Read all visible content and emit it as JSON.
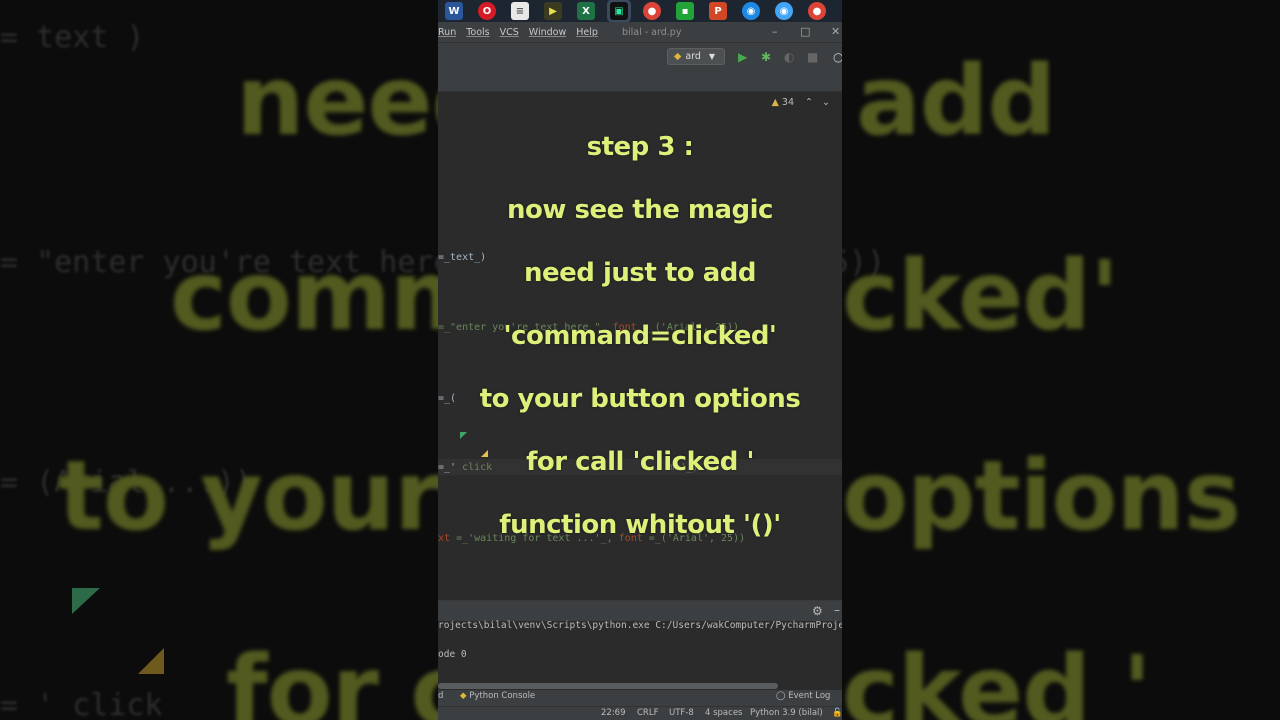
{
  "background": {
    "code_lines": [
      "= text )",
      "= \"enter you're text here \" font = ('Arial', 25))",
      "= (Arial ...))",
      "= ' click",
      "= '' "
    ],
    "big_words": [
      "need",
      "add",
      "comm",
      "cked'",
      "to your",
      "options",
      "for c",
      "cked '"
    ]
  },
  "taskbar": {
    "icons": [
      "word-icon",
      "opera-icon",
      "document-icon",
      "media-icon",
      "excel-icon",
      "pycharm-icon",
      "chrome-icon",
      "app-icon",
      "powerpoint-icon",
      "browser-icon",
      "browser2-icon",
      "chrome2-icon"
    ]
  },
  "menu": {
    "items": [
      "Run",
      "Tools",
      "VCS",
      "Window",
      "Help"
    ],
    "title": "bilal - ard.py"
  },
  "toolbar": {
    "run_config": "ard"
  },
  "editor": {
    "warnings_count": "34",
    "lines": {
      "l1_text": "=_text_)",
      "l2_a": "=_\"enter you're text here \"_",
      "l2_kw": "font",
      "l2_b": "=_('Arial', 25))",
      "l3": "=_(",
      "l4_a": "=_'",
      "l4_b": "click",
      "l4_c": "me'_)",
      "l5_kw": "xt",
      "l5_a": "=_'waiting for text ...'_,",
      "l5_kw2": "font",
      "l5_b": "=_('Arial', 25))"
    }
  },
  "console": {
    "line1": "rojects\\bilal\\venv\\Scripts\\python.exe C:/Users/wakComputer/PycharmProjects/",
    "line2": "ode 0"
  },
  "toolwindows": {
    "python_console": "Python Console",
    "event_log": "Event Log",
    "left_stub": "d"
  },
  "status": {
    "position": "22:69",
    "line_sep": "CRLF",
    "encoding": "UTF-8",
    "indent": "4 spaces",
    "interpreter": "Python 3.9 (bilal)"
  },
  "caption": {
    "line1": "step 3 :",
    "line2": "now see the magic",
    "line3": "need just to add",
    "line4": "'command=clicked'",
    "line5": "to your  button options",
    "line6": "for call 'clicked '",
    "line7": "function whitout '()'"
  },
  "colors": {
    "caption": "#dff07a",
    "editor_bg": "#2b2b2b",
    "chrome_bg": "#3c3f41"
  }
}
